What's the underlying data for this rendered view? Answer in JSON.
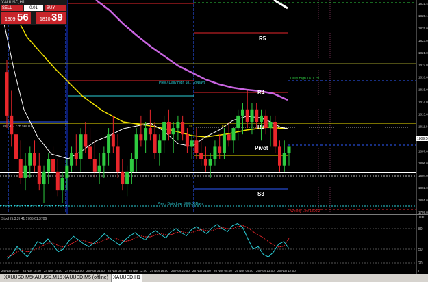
{
  "window": {
    "title": "XAUUSD,H1"
  },
  "trade_panel": {
    "sell_label": "SELL",
    "buy_label": "BUY",
    "lot": "0.01",
    "sell_big": "1809",
    "sell_pips": "56",
    "buy_big": "1810",
    "buy_pips": "39"
  },
  "levels": {
    "r5": "R5",
    "r4": "R4",
    "r3": "R3",
    "pivot": "Pivot",
    "s3": "S3",
    "prev_daily_high": "Prev / Daily High 1817.20Days",
    "daily_high": "Daily High 1811.79",
    "prev_daily_low": "Prev / Daily Low 1800.56Days",
    "weekly_low": "Weekly Low 1800.2",
    "left_marker": "#1020 - 72h sell 0.01",
    "d1_a": "D1",
    "d1_b": "D1"
  },
  "price_axis": [
    "1831.4",
    "1825.1",
    "1825.0",
    "1823.0",
    "1821.0",
    "1819.0",
    "1818.0",
    "1815.0",
    "1814.0",
    "1813.0",
    "1811.0",
    "1809.0",
    "1807.0",
    "1806.0",
    "1804.0",
    "1802.0",
    "1801.0",
    "1799.0"
  ],
  "current_price": "1809.56",
  "indicator": {
    "title": "Stoch(5,3,3) 41.1765 61.3706",
    "axis": [
      "100",
      "80",
      "50",
      "20",
      "0"
    ]
  },
  "time_axis": [
    "24 Nov 2020",
    "24 Nov 15:00",
    "24 Nov 19:00",
    "24 Nov 23:00",
    "25 Nov 04:00",
    "25 Nov 08:00",
    "25 Nov 12:00",
    "25 Nov 16:00",
    "25 Nov 20:00",
    "26 Nov 01:00",
    "26 Nov 05:00",
    "26 Nov 09:00",
    "26 Nov 13:00",
    "26 Nov 17:00"
  ],
  "tabs": [
    "XAUUSD,M5",
    "XAUUSD,M15",
    "XAUUSD,M5 (offline)",
    "XAUUSD,H1"
  ],
  "active_tab": "XAUUSD,H1",
  "colors": {
    "bull": "#2ecc40",
    "bear": "#e8262b",
    "ma_yellow": "#f2e200",
    "ma_magenta": "#c864e0",
    "ma_white": "#ffffff",
    "pivot_red": "#e8262b",
    "level_blue": "#2e5bff",
    "cyan": "#2ccfd8"
  },
  "chart_data": {
    "type": "candlestick",
    "ylim": [
      1798.5,
      1832.0
    ],
    "candles": [
      [
        1821,
        1823,
        1812,
        1814
      ],
      [
        1814,
        1818,
        1809,
        1811
      ],
      [
        1811,
        1813,
        1806,
        1807
      ],
      [
        1807,
        1810,
        1803,
        1804
      ],
      [
        1804,
        1808,
        1802,
        1806
      ],
      [
        1806,
        1809,
        1804,
        1808
      ],
      [
        1808,
        1810,
        1805,
        1806
      ],
      [
        1806,
        1808,
        1802,
        1803
      ],
      [
        1803,
        1806,
        1800,
        1805
      ],
      [
        1805,
        1808,
        1803,
        1807
      ],
      [
        1807,
        1809,
        1804,
        1805
      ],
      [
        1805,
        1807,
        1801,
        1802
      ],
      [
        1802,
        1805,
        1800,
        1804
      ],
      [
        1804,
        1807,
        1802,
        1806
      ],
      [
        1806,
        1809,
        1805,
        1808
      ],
      [
        1808,
        1811,
        1806,
        1807
      ],
      [
        1807,
        1812,
        1805,
        1811
      ],
      [
        1811,
        1813,
        1808,
        1809
      ],
      [
        1809,
        1812,
        1806,
        1807
      ],
      [
        1807,
        1810,
        1804,
        1805
      ],
      [
        1805,
        1808,
        1803,
        1806
      ],
      [
        1806,
        1809,
        1804,
        1808
      ],
      [
        1808,
        1812,
        1806,
        1811
      ],
      [
        1811,
        1814,
        1808,
        1809
      ],
      [
        1809,
        1811,
        1804,
        1805
      ],
      [
        1805,
        1807,
        1802,
        1803
      ],
      [
        1803,
        1806,
        1801,
        1805
      ],
      [
        1805,
        1808,
        1803,
        1807
      ],
      [
        1807,
        1812,
        1805,
        1811
      ],
      [
        1811,
        1814,
        1809,
        1810
      ],
      [
        1810,
        1813,
        1808,
        1812
      ],
      [
        1812,
        1815,
        1810,
        1811
      ],
      [
        1811,
        1813,
        1807,
        1808
      ],
      [
        1808,
        1811,
        1806,
        1810
      ],
      [
        1810,
        1814,
        1808,
        1813
      ],
      [
        1813,
        1815,
        1810,
        1811
      ],
      [
        1811,
        1813,
        1808,
        1812
      ],
      [
        1812,
        1814,
        1810,
        1813
      ],
      [
        1813,
        1814,
        1810,
        1811
      ],
      [
        1811,
        1812,
        1808,
        1809
      ],
      [
        1809,
        1811,
        1807,
        1810
      ],
      [
        1810,
        1812,
        1807,
        1808
      ],
      [
        1808,
        1810,
        1806,
        1807
      ],
      [
        1807,
        1809,
        1805,
        1806
      ],
      [
        1806,
        1808,
        1804,
        1807
      ],
      [
        1807,
        1810,
        1806,
        1809
      ],
      [
        1809,
        1811,
        1807,
        1808
      ],
      [
        1808,
        1812,
        1807,
        1811
      ],
      [
        1811,
        1813,
        1809,
        1810
      ],
      [
        1810,
        1812,
        1808,
        1812
      ],
      [
        1812,
        1815,
        1810,
        1814
      ],
      [
        1814,
        1816,
        1811,
        1815
      ],
      [
        1815,
        1818,
        1812,
        1813
      ],
      [
        1813,
        1816,
        1811,
        1815
      ],
      [
        1815,
        1816,
        1812,
        1813
      ],
      [
        1813,
        1815,
        1810,
        1814
      ],
      [
        1814,
        1815,
        1811,
        1812
      ],
      [
        1812,
        1814,
        1809,
        1813
      ],
      [
        1813,
        1814,
        1808,
        1809
      ],
      [
        1809,
        1810,
        1805,
        1806
      ],
      [
        1806,
        1810,
        1805,
        1808
      ],
      [
        1808,
        1809,
        1806,
        1809
      ]
    ],
    "stoch_main": [
      20,
      30,
      45,
      35,
      25,
      40,
      55,
      50,
      60,
      48,
      35,
      40,
      55,
      65,
      58,
      50,
      45,
      52,
      60,
      70,
      62,
      55,
      48,
      58,
      66,
      72,
      64,
      58,
      70,
      76,
      68,
      62,
      74,
      80,
      72,
      66,
      78,
      84,
      76,
      70,
      82,
      88,
      80,
      74,
      86,
      90,
      82,
      60,
      40,
      45,
      30,
      25,
      35,
      50,
      55,
      41
    ],
    "stoch_signal": [
      25,
      28,
      35,
      38,
      35,
      37,
      42,
      47,
      52,
      52,
      47,
      44,
      47,
      53,
      58,
      57,
      53,
      51,
      53,
      58,
      62,
      62,
      58,
      55,
      57,
      62,
      66,
      64,
      64,
      68,
      70,
      68,
      68,
      72,
      74,
      72,
      72,
      76,
      78,
      76,
      76,
      80,
      82,
      80,
      80,
      84,
      86,
      82,
      74,
      68,
      62,
      55,
      48,
      44,
      46,
      61
    ]
  }
}
